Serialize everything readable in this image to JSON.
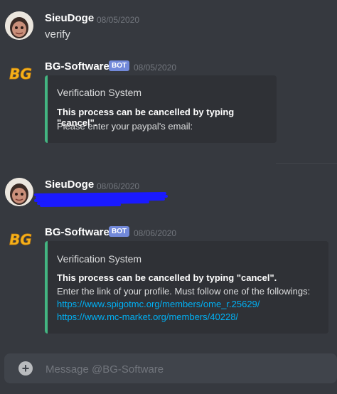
{
  "messages": [
    {
      "username": "SieuDoge",
      "timestamp": "08/05/2020",
      "text": "verify"
    },
    {
      "username": "BG-Software",
      "badge": "BOT",
      "timestamp": "08/05/2020",
      "embed": {
        "title": "Verification System",
        "bold": "This process can be cancelled by typing \"cancel\".",
        "line1": "Please enter your paypal's email:"
      }
    },
    {
      "username": "SieuDoge",
      "timestamp": "08/06/2020"
    },
    {
      "username": "BG-Software",
      "badge": "BOT",
      "timestamp": "08/06/2020",
      "embed": {
        "title": "Verification System",
        "bold": "This process can be cancelled by typing \"cancel\".",
        "line1": "Enter the link of your profile. Must follow one of the followings:",
        "link1": "https://www.spigotmc.org/members/ome_r.25629/",
        "link2": "https://www.mc-market.org/members/40228/"
      }
    }
  ],
  "avatars": {
    "bot_logo_text": "BG"
  },
  "composer": {
    "placeholder": "Message @BG-Software",
    "add_icon": "plus-circle-icon"
  },
  "colors": {
    "embed_border": "#43b581",
    "link": "#00b0f4",
    "bot_badge": "#7289da",
    "background": "#36393f"
  }
}
